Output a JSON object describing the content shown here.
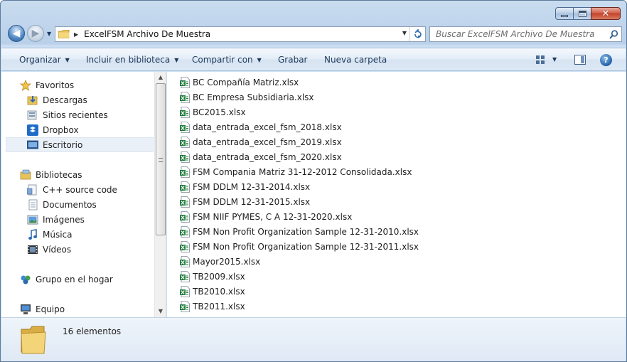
{
  "window": {
    "title": "ExcelFSM Archivo De Muestra"
  },
  "address_bar": {
    "path": "ExcelFSM Archivo De Muestra"
  },
  "search": {
    "placeholder": "Buscar ExcelFSM Archivo De Muestra"
  },
  "toolbar": {
    "organize": "Organizar",
    "include_library": "Incluir en biblioteca",
    "share": "Compartir con",
    "burn": "Grabar",
    "new_folder": "Nueva carpeta"
  },
  "sidebar": {
    "favorites": [
      {
        "label": "Favoritos",
        "icon": "star-icon"
      },
      {
        "label": "Descargas",
        "icon": "downloads-icon"
      },
      {
        "label": "Sitios recientes",
        "icon": "recent-places-icon"
      },
      {
        "label": "Dropbox",
        "icon": "dropbox-icon"
      },
      {
        "label": "Escritorio",
        "icon": "desktop-icon",
        "selected": true
      }
    ],
    "libraries": [
      {
        "label": "Bibliotecas",
        "icon": "libraries-icon"
      },
      {
        "label": "C++ source code",
        "icon": "library-folder-icon"
      },
      {
        "label": "Documentos",
        "icon": "documents-icon"
      },
      {
        "label": "Imágenes",
        "icon": "pictures-icon"
      },
      {
        "label": "Música",
        "icon": "music-icon"
      },
      {
        "label": "Vídeos",
        "icon": "videos-icon"
      }
    ],
    "homegroup": {
      "label": "Grupo en el hogar",
      "icon": "homegroup-icon"
    },
    "computer": {
      "label": "Equipo",
      "icon": "computer-icon"
    }
  },
  "files": [
    "BC Compañía Matriz.xlsx",
    "BC Empresa Subsidiaria.xlsx",
    "BC2015.xlsx",
    "data_entrada_excel_fsm_2018.xlsx",
    "data_entrada_excel_fsm_2019.xlsx",
    "data_entrada_excel_fsm_2020.xlsx",
    "FSM Compania Matriz 31-12-2012 Consolidada.xlsx",
    "FSM DDLM 12-31-2014.xlsx",
    "FSM DDLM 12-31-2015.xlsx",
    "FSM NIIF PYMES, C A  12-31-2020.xlsx",
    "FSM Non Profit Organization Sample 12-31-2010.xlsx",
    "FSM Non Profit Organization Sample 12-31-2011.xlsx",
    "Mayor2015.xlsx",
    "TB2009.xlsx",
    "TB2010.xlsx",
    "TB2011.xlsx"
  ],
  "details": {
    "item_count": "16 elementos"
  },
  "colors": {
    "excel_green": "#1d7a3a",
    "toolbar_text": "#1e395b",
    "selection": "#eaf0f8"
  }
}
